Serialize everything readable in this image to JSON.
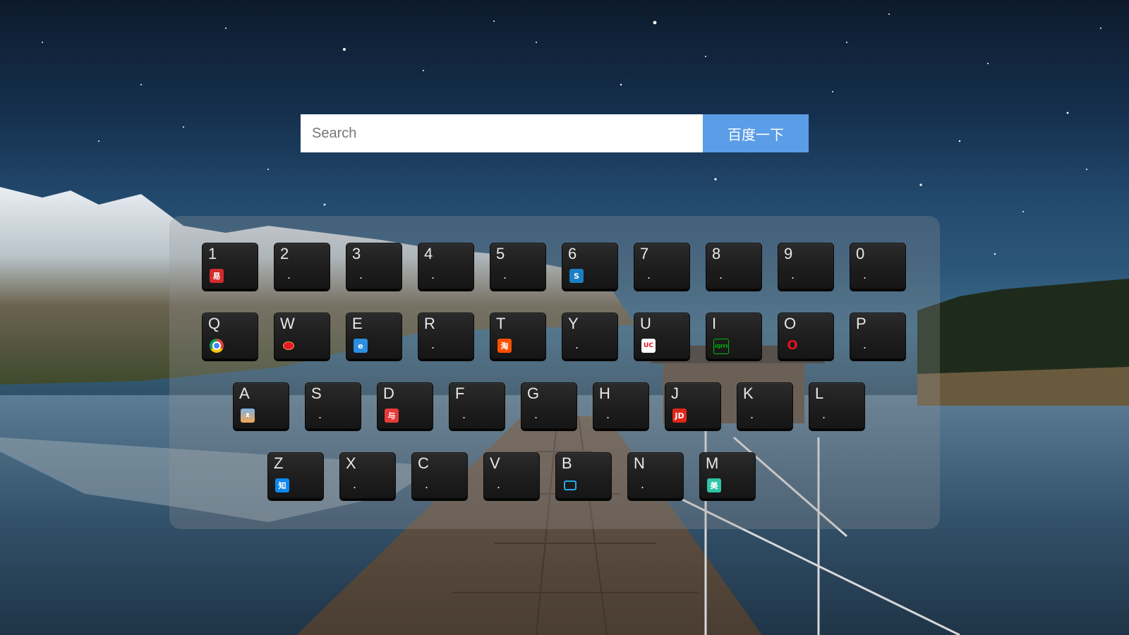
{
  "search": {
    "placeholder": "Search",
    "value": "",
    "button_label": "百度一下",
    "button_color": "#5b9de6"
  },
  "keyboard": {
    "rows": [
      [
        {
          "key": "1",
          "icon": "netease-163-icon",
          "icon_text": "易",
          "color": "#d32b2b"
        },
        {
          "key": "2",
          "icon": "",
          "dot": "."
        },
        {
          "key": "3",
          "icon": "",
          "dot": "."
        },
        {
          "key": "4",
          "icon": "",
          "dot": "."
        },
        {
          "key": "5",
          "icon": "",
          "dot": "."
        },
        {
          "key": "6",
          "icon": "china-mobile-icon",
          "icon_text": "S",
          "color": "#1b7fc4"
        },
        {
          "key": "7",
          "icon": "",
          "dot": "."
        },
        {
          "key": "8",
          "icon": "",
          "dot": "."
        },
        {
          "key": "9",
          "icon": "",
          "dot": "."
        },
        {
          "key": "0",
          "icon": "",
          "dot": "."
        }
      ],
      [
        {
          "key": "Q",
          "icon": "chrome-icon",
          "icon_text": "",
          "color": "#e8c433"
        },
        {
          "key": "W",
          "icon": "weibo-icon",
          "icon_text": "",
          "color": "#e6162d"
        },
        {
          "key": "E",
          "icon": "ie-browser-icon",
          "icon_text": "e",
          "color": "#2a8fe0"
        },
        {
          "key": "R",
          "icon": "",
          "dot": "."
        },
        {
          "key": "T",
          "icon": "taobao-icon",
          "icon_text": "淘",
          "color": "#ff5000"
        },
        {
          "key": "Y",
          "icon": "",
          "dot": "."
        },
        {
          "key": "U",
          "icon": "uc-browser-icon",
          "icon_text": "UC",
          "color": "#ffffff"
        },
        {
          "key": "I",
          "icon": "iqiyi-icon",
          "icon_text": "iQIYI",
          "color": "#00be06"
        },
        {
          "key": "O",
          "icon": "opera-icon",
          "icon_text": "O",
          "color": "#e2131c"
        },
        {
          "key": "P",
          "icon": "",
          "dot": "."
        }
      ],
      [
        {
          "key": "A",
          "icon": "cartoon-cat-icon",
          "icon_text": "",
          "color": "#4a90d9"
        },
        {
          "key": "S",
          "icon": "",
          "dot": "."
        },
        {
          "key": "D",
          "icon": "douyu-icon",
          "icon_text": "与",
          "color": "#e83a3a"
        },
        {
          "key": "F",
          "icon": "",
          "dot": "."
        },
        {
          "key": "G",
          "icon": "",
          "dot": "."
        },
        {
          "key": "H",
          "icon": "",
          "dot": "."
        },
        {
          "key": "J",
          "icon": "jd-icon",
          "icon_text": "JD",
          "color": "#e1251b"
        },
        {
          "key": "K",
          "icon": "",
          "dot": "."
        },
        {
          "key": "L",
          "icon": "",
          "dot": "."
        }
      ],
      [
        {
          "key": "Z",
          "icon": "zhihu-icon",
          "icon_text": "知",
          "color": "#0f88eb"
        },
        {
          "key": "X",
          "icon": "",
          "dot": "."
        },
        {
          "key": "C",
          "icon": "",
          "dot": "."
        },
        {
          "key": "V",
          "icon": "",
          "dot": "."
        },
        {
          "key": "B",
          "icon": "bilibili-icon",
          "icon_text": "",
          "color": "#23ade5"
        },
        {
          "key": "N",
          "icon": "",
          "dot": "."
        },
        {
          "key": "M",
          "icon": "meituan-icon",
          "icon_text": "美",
          "color": "#2ec4a6"
        }
      ]
    ]
  }
}
